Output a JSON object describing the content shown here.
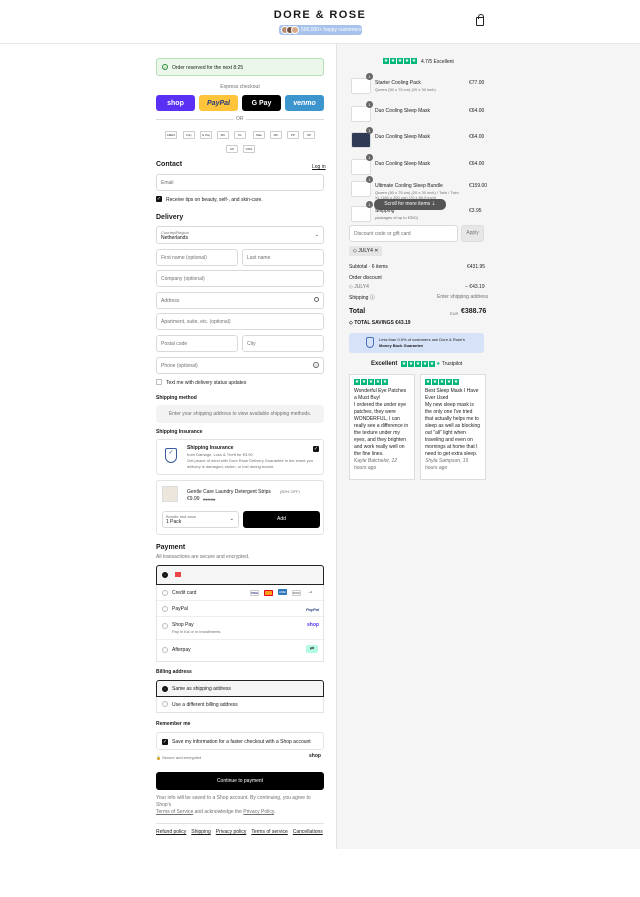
{
  "header": {
    "brand": "DORE & ROSE",
    "happy_customers": "500,000+ happy customers"
  },
  "notice": {
    "text": "Order reserved for the next 8:25"
  },
  "express": {
    "title": "Express checkout",
    "buttons": [
      {
        "label": "shop",
        "color": "#5a31f4"
      },
      {
        "label": "PayPal",
        "color": "#ffc439"
      },
      {
        "label": "G Pay",
        "color": "#000000"
      },
      {
        "label": "venmo",
        "color": "#3d95ce"
      }
    ],
    "or": "OR"
  },
  "payment_icons": [
    "AMEX",
    "Pay",
    "G Pay",
    "MC",
    "KL",
    "Mae",
    "MC",
    "PP",
    "SP",
    "UP",
    "VISA"
  ],
  "contact": {
    "title": "Contact",
    "login": "Log in",
    "email_placeholder": "Email",
    "news_label": "Receive tips on beauty, self-, and skin-care."
  },
  "delivery": {
    "title": "Delivery",
    "country_label": "Country/Region",
    "country": "Netherlands",
    "first_name": "First name (optional)",
    "last_name": "Last name",
    "company": "Company (optional)",
    "address": "Address",
    "apartment": "Apartment, suite, etc. (optional)",
    "postal": "Postal code",
    "city": "City",
    "phone": "Phone (optional)",
    "sms_label": "Text me with delivery status updates"
  },
  "shipping": {
    "title": "Shipping method",
    "placeholder": "Enter your shipping address to view available shipping methods."
  },
  "insurance": {
    "title": "Shipping Insurance",
    "item": "Shipping Insurance",
    "line1": "from Damage, Loss & Theft for €3.90",
    "line2": "Get peace of mind with Dore Rose Delivery Guarantee in the event your",
    "line3": "delivery is damaged, stolen, or lost during transit."
  },
  "upsell": {
    "name": "Gentle Care Laundry Detergent Strips",
    "discount": "(50% OFF)",
    "price": "€9.99",
    "old_price": "€19.98",
    "select_label": "Bundle and save",
    "select_value": "1 Pack",
    "add": "Add"
  },
  "payment": {
    "title": "Payment",
    "subtitle": "All transactions are secure and encrypted.",
    "methods": [
      "Credit card",
      "PayPal",
      "Shop Pay",
      "Afterpay"
    ],
    "shop_pay_sub": "Pay in full or in installments",
    "paypal_logo": "PayPal",
    "shop_logo": "shop",
    "card_logos": [
      "VISA",
      "MC",
      "AMEX",
      "DISC",
      "+4"
    ]
  },
  "billing": {
    "title": "Billing address",
    "same": "Same as shipping address",
    "different": "Use a different billing address"
  },
  "remember": {
    "title": "Remember me",
    "save_label": "Save my information for a faster checkout with a Shop account",
    "secure": "Secure and encrypted",
    "shop": "shop"
  },
  "pay_button": "Continue to payment",
  "legal": {
    "line1": "Your info will be saved to a Shop account. By continuing, you agree to Shop's",
    "terms": "Terms of Service",
    "mid": "and acknowledge the",
    "privacy": "Privacy Policy"
  },
  "footer_links": [
    "Refund policy",
    "Shipping",
    "Privacy policy",
    "Terms of service",
    "Cancellations"
  ],
  "rating": {
    "score": "4.7/5 Excellent"
  },
  "cart": [
    {
      "qty": "1",
      "name": "Starter Cooling Pack",
      "sub": "Queen (50 x 75 cm) (20 x 30 inch)",
      "price": "€77.00"
    },
    {
      "qty": "1",
      "name": "Duo Cooling Sleep Mask",
      "sub": "",
      "price": "€64.00"
    },
    {
      "qty": "1",
      "name": "Duo Cooling Sleep Mask",
      "sub": "",
      "price": "€64.00"
    },
    {
      "qty": "1",
      "name": "Duo Cooling Sleep Mask",
      "sub": "",
      "price": "€64.00"
    },
    {
      "qty": "1",
      "name": "Ultimate Cooling Sleep Bundle",
      "sub": "Queen (50 x 75 cm) (20 x 30 inch) / Twin / Twin XL (180 x 200 cm) (70 x 80.5 inch)",
      "price": "€159.00"
    },
    {
      "qty": "1",
      "name": "Shipping",
      "sub": "packages of up to €300)",
      "price": "€3.95"
    }
  ],
  "scroll_hint": "Scroll for more items",
  "discount": {
    "placeholder": "Discount code or gift card",
    "apply": "Apply",
    "tag": "JULY4"
  },
  "summary": {
    "subtotal_label": "Subtotal · 6 items",
    "subtotal": "€431.95",
    "order_discount": "Order discount",
    "code": "JULY4",
    "code_value": "− €43.19",
    "shipping_label": "Shipping",
    "shipping_value": "Enter shipping address",
    "total_label": "Total",
    "currency": "EUR",
    "total": "€388.76",
    "savings": "TOTAL SAVINGS €43.19"
  },
  "guarantee": {
    "line1": "Less than 0.5% of customers use Dore & Rose's",
    "line2": "Money Back Guarantee"
  },
  "trustpilot": {
    "label": "Excellent",
    "brand": "Trustpilot"
  },
  "reviews": [
    {
      "title": "Wonderful Eye Patches a Must Buy!",
      "body": "I ordered the under eye patches, they were WONDERFUL, I can really see a difference in the texture under my eyes, and they brighten and work really well on the fine lines.",
      "author": "Kayle Batchelor, 12 hours ago"
    },
    {
      "title": "Best Sleep Mask I Have Ever Used",
      "body": "My new sleep mask is the only one I've tried that actually helps me to sleep as well as blocking out \"all\" light when traveling and even on mornings at home that I need to get extra sleep.",
      "author": "Shyla Sampson, 15 hours ago"
    }
  ],
  "colors": {
    "accent": "#000000",
    "trust_green": "#00b67a",
    "notice_bg": "#eaf7ea"
  }
}
